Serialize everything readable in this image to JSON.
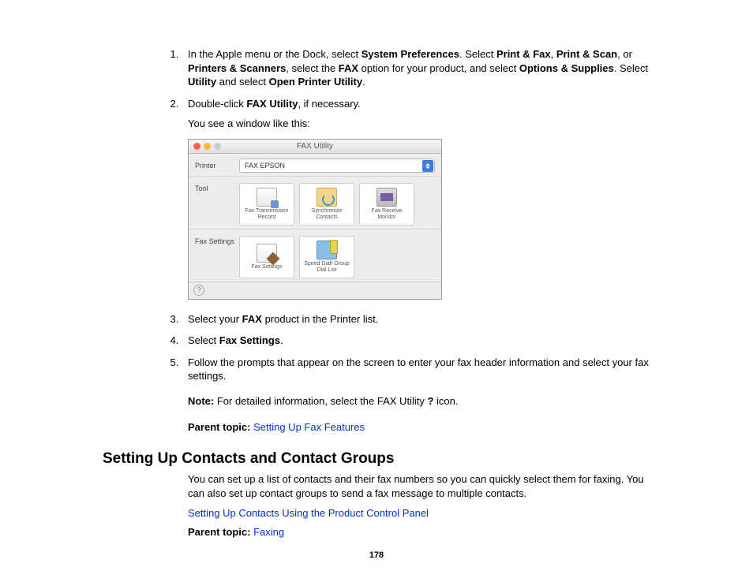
{
  "steps": {
    "s1_a": "In the Apple menu or the Dock, select ",
    "s1_b": "System Preferences",
    "s1_c": ". Select ",
    "s1_d": "Print & Fax",
    "s1_e": ", ",
    "s1_f": "Print & Scan",
    "s1_g": ", or ",
    "s1_h": "Printers & Scanners",
    "s1_i": ", select the ",
    "s1_j": "FAX",
    "s1_k": " option for your product, and select ",
    "s1_l": "Options & Supplies",
    "s1_m": ". Select ",
    "s1_n": "Utility",
    "s1_o": " and select ",
    "s1_p": "Open Printer Utility",
    "s1_q": ".",
    "s2_a": "Double-click ",
    "s2_b": "FAX Utility",
    "s2_c": ", if necessary.",
    "s2_after": "You see a window like this:",
    "s3_a": "Select your ",
    "s3_b": "FAX",
    "s3_c": " product in the Printer list.",
    "s4_a": "Select ",
    "s4_b": "Fax Settings",
    "s4_c": ".",
    "s5": "Follow the prompts that appear on the screen to enter your fax header information and select your fax settings."
  },
  "note": {
    "label": "Note:",
    "body_a": " For detailed information, select the FAX Utility ",
    "body_b": "?",
    "body_c": " icon."
  },
  "parent1": {
    "label": "Parent topic:",
    "link": "Setting Up Fax Features"
  },
  "heading2": "Setting Up Contacts and Contact Groups",
  "para2": "You can set up a list of contacts and their fax numbers so you can quickly select them for faxing. You can also set up contact groups to send a fax message to multiple contacts.",
  "link2": "Setting Up Contacts Using the Product Control Panel",
  "parent2": {
    "label": "Parent topic:",
    "link": "Faxing"
  },
  "page_number": "178",
  "window": {
    "title": "FAX Utility",
    "label_printer": "Printer",
    "label_tool": "Tool",
    "label_settings": "Fax Settings",
    "dropdown_value": "FAX EPSON",
    "icons": {
      "tool1": "Fax Transmission Record",
      "tool2": "Synchronize Contacts",
      "tool3": "Fax Receive Monitor",
      "set1": "Fax Settings",
      "set2": "Speed Dial/ Group Dial List"
    },
    "help": "?"
  }
}
